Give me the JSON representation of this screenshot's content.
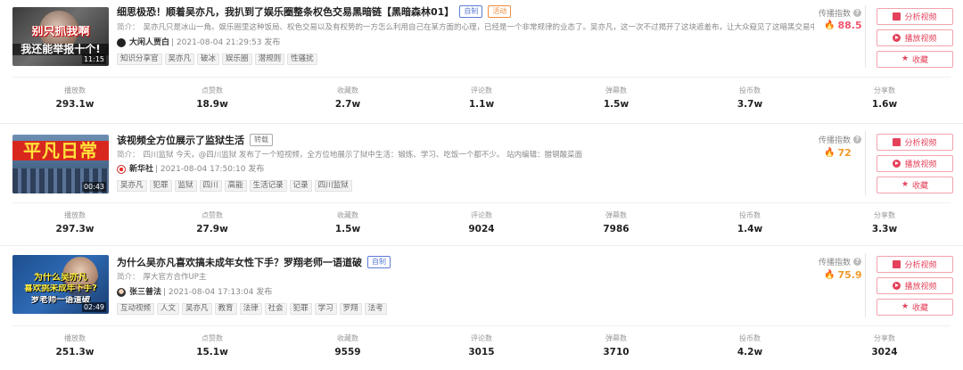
{
  "videos": [
    {
      "title": "细思极恐！顺着吴亦凡，我扒到了娱乐圈整条权色交易黑暗链【黑暗森林01】",
      "tags": [
        {
          "label": "自制",
          "color": "#5b7bd5"
        },
        {
          "label": "活动",
          "color": "#f08c3c"
        }
      ],
      "intro_label": "简介：",
      "intro": "吴亦凡只是冰山一角。娱乐圈里这种饭局、权色交易以及有权势的一方怎么利用自己在某方面的心理，已经是一个非常规律的业态了。吴亦凡，这一次不过揭开了这块遮羞布，让大众窥见了这暗黑交易中的冰山...",
      "author": "大闲人贾白",
      "published": "| 2021-08-04 21:29:53 发布",
      "keywords": [
        "知识分享官",
        "吴亦凡",
        "破冰",
        "娱乐圈",
        "潜规则",
        "性骚扰"
      ],
      "thumb_caption_1": "别只抓我啊",
      "thumb_caption_2": "我还能举报十个!",
      "duration": "11:15",
      "index_label": "传播指数",
      "index_value": "88.5",
      "index_color": "#f0566e",
      "buttons": {
        "analyze": "分析视频",
        "play": "播放视频",
        "collect": "收藏"
      },
      "stats": [
        {
          "label": "播放数",
          "value": "293.1w"
        },
        {
          "label": "点赞数",
          "value": "18.9w"
        },
        {
          "label": "收藏数",
          "value": "2.7w"
        },
        {
          "label": "评论数",
          "value": "1.1w"
        },
        {
          "label": "弹幕数",
          "value": "1.5w"
        },
        {
          "label": "投币数",
          "value": "3.7w"
        },
        {
          "label": "分享数",
          "value": "1.6w"
        }
      ]
    },
    {
      "title": "该视频全方位展示了监狱生活",
      "tags": [
        {
          "label": "转载",
          "color": "#777777"
        }
      ],
      "intro_label": "简介：",
      "intro": "四川监狱 今天，@四川监狱 发布了一个短视频，全方位地展示了狱中生活：锻炼、学习、吃饭一个都不少。 站内编辑：腊钢酸菜面",
      "author": "新华社",
      "published": "| 2021-08-04 17:50:10 发布",
      "keywords": [
        "吴亦凡",
        "犯罪",
        "监狱",
        "四川",
        "高能",
        "生活记录",
        "记录",
        "四川监狱"
      ],
      "thumb_caption_1": "平凡日常",
      "thumb_caption_2": "",
      "duration": "00:43",
      "index_label": "传播指数",
      "index_value": "72",
      "index_color": "#f09a2c",
      "buttons": {
        "analyze": "分析视频",
        "play": "播放视频",
        "collect": "收藏"
      },
      "stats": [
        {
          "label": "播放数",
          "value": "297.3w"
        },
        {
          "label": "点赞数",
          "value": "27.9w"
        },
        {
          "label": "收藏数",
          "value": "1.5w"
        },
        {
          "label": "评论数",
          "value": "9024"
        },
        {
          "label": "弹幕数",
          "value": "7986"
        },
        {
          "label": "投币数",
          "value": "1.4w"
        },
        {
          "label": "分享数",
          "value": "3.3w"
        }
      ]
    },
    {
      "title": "为什么吴亦凡喜欢搞未成年女性下手？罗翔老师一语道破",
      "tags": [
        {
          "label": "自制",
          "color": "#5b7bd5"
        }
      ],
      "intro_label": "简介：",
      "intro": "厚大官方合作UP主",
      "author": "张三普法",
      "published": "| 2021-08-04 17:13:04 发布",
      "keywords": [
        "互动视频",
        "人文",
        "吴亦凡",
        "教育",
        "法律",
        "社会",
        "犯罪",
        "学习",
        "罗翔",
        "法考"
      ],
      "thumb_caption_1": "为什么吴亦凡",
      "thumb_caption_2": "喜欢挑未成年下手?",
      "thumb_caption_3": "罗老师一语道破",
      "duration": "02:49",
      "index_label": "传播指数",
      "index_value": "75.9",
      "index_color": "#f09a2c",
      "buttons": {
        "analyze": "分析视频",
        "play": "播放视频",
        "collect": "收藏"
      },
      "stats": [
        {
          "label": "播放数",
          "value": "251.3w"
        },
        {
          "label": "点赞数",
          "value": "15.1w"
        },
        {
          "label": "收藏数",
          "value": "9559"
        },
        {
          "label": "评论数",
          "value": "3015"
        },
        {
          "label": "弹幕数",
          "value": "3710"
        },
        {
          "label": "投币数",
          "value": "4.2w"
        },
        {
          "label": "分享数",
          "value": "3024"
        }
      ]
    }
  ]
}
